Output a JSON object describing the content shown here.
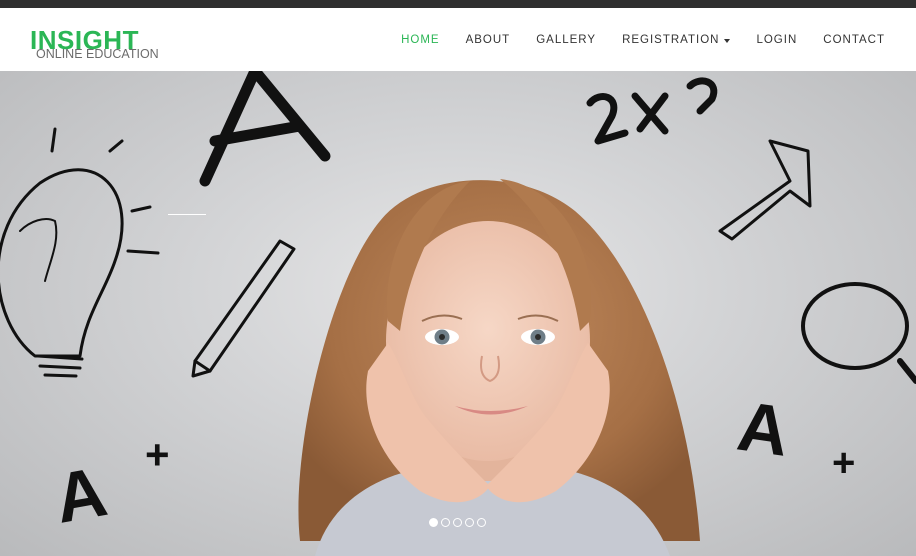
{
  "brand": {
    "name": "INSIGHT",
    "tagline": "ONLINE EDUCATION"
  },
  "nav": {
    "items": [
      {
        "label": "HOME",
        "active": true
      },
      {
        "label": "ABOUT"
      },
      {
        "label": "GALLERY"
      },
      {
        "label": "REGISTRATION",
        "dropdown": true
      },
      {
        "label": "LOGIN"
      },
      {
        "label": "CONTACT"
      }
    ]
  },
  "hero": {
    "doodles": {
      "grade_a_plus": "A",
      "plus": "+",
      "formula": "2x2"
    },
    "slides": {
      "count": 5,
      "active_index": 0
    }
  },
  "colors": {
    "accent": "#2bb655",
    "topbar": "#2f2f2f",
    "nav_text": "#333333"
  }
}
